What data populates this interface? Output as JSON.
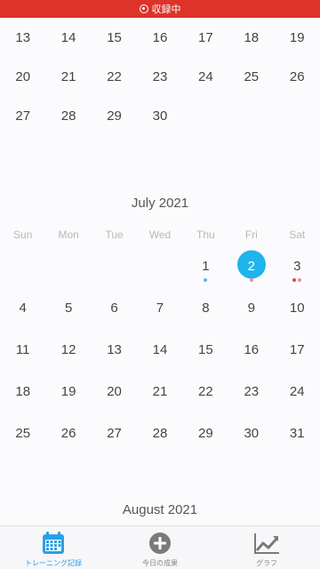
{
  "status_bar": {
    "recording_label": "収録中"
  },
  "colors": {
    "accent": "#1fb4ea",
    "recording": "#dd3329",
    "dot_blue": "#5cb3f0",
    "dot_red": "#e04b3b",
    "dot_pink": "#f08aa0"
  },
  "june": {
    "rows": [
      [
        "13",
        "14",
        "15",
        "16",
        "17",
        "18",
        "19"
      ],
      [
        "20",
        "21",
        "22",
        "23",
        "24",
        "25",
        "26"
      ],
      [
        "27",
        "28",
        "29",
        "30",
        "",
        "",
        ""
      ]
    ]
  },
  "july": {
    "title": "July 2021",
    "weekdays": [
      "Sun",
      "Mon",
      "Tue",
      "Wed",
      "Thu",
      "Fri",
      "Sat"
    ],
    "rows": [
      [
        "",
        "",
        "",
        "",
        "1",
        "2",
        "3"
      ],
      [
        "4",
        "5",
        "6",
        "7",
        "8",
        "9",
        "10"
      ],
      [
        "11",
        "12",
        "13",
        "14",
        "15",
        "16",
        "17"
      ],
      [
        "18",
        "19",
        "20",
        "21",
        "22",
        "23",
        "24"
      ],
      [
        "25",
        "26",
        "27",
        "28",
        "29",
        "30",
        "31"
      ]
    ],
    "selected_day": "2"
  },
  "august": {
    "title": "August 2021"
  },
  "tabs": [
    {
      "label": "トレーニング記録",
      "icon": "calendar-icon",
      "active": true
    },
    {
      "label": "今日の成果",
      "icon": "plus-circle-icon",
      "active": false
    },
    {
      "label": "グラフ",
      "icon": "line-chart-icon",
      "active": false
    }
  ]
}
